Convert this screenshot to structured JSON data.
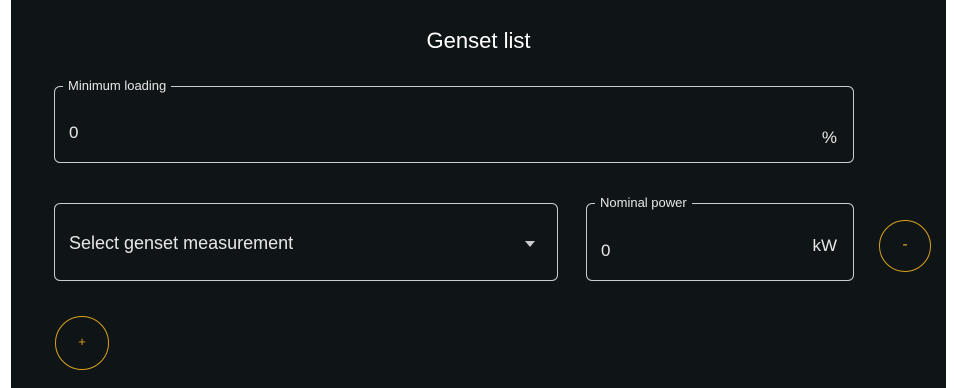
{
  "title": "Genset list",
  "minimum_loading": {
    "label": "Minimum loading",
    "value": "0",
    "unit": "%"
  },
  "genset_select": {
    "placeholder": "Select genset measurement"
  },
  "nominal_power": {
    "label": "Nominal power",
    "value": "0",
    "unit": "kW"
  },
  "buttons": {
    "remove_label": "-",
    "add_label": "+"
  },
  "colors": {
    "background": "#0f1416",
    "accent": "#d9a21b",
    "border": "#c9cdd0"
  }
}
